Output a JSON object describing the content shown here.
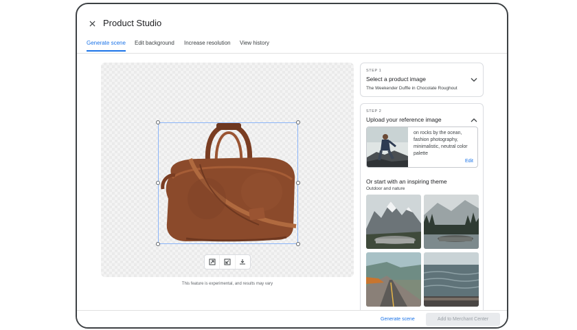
{
  "app": {
    "title": "Product Studio"
  },
  "tabs": [
    {
      "label": "Generate scene",
      "active": true
    },
    {
      "label": "Edit background",
      "active": false
    },
    {
      "label": "Increase resolution",
      "active": false
    },
    {
      "label": "View history",
      "active": false
    }
  ],
  "canvas": {
    "disclaimer": "This feature is experimental, and results may vary",
    "toolbar_icons": [
      "fit-to-frame-icon",
      "shrink-product-icon",
      "download-icon"
    ]
  },
  "step1": {
    "label": "STEP 1",
    "title": "Select a product image",
    "subtitle": "The Weekender Duffle in Chocolate Roughout",
    "expanded": false
  },
  "step2": {
    "label": "STEP 2",
    "title": "Upload your reference image",
    "expanded": true,
    "prompt": "on rocks by the ocean, fashion photography, minimalistic, neutral color palette",
    "edit_label": "Edit",
    "theme_title": "Or start with an inspiring theme",
    "theme_category": "Outdoor and nature",
    "themes": [
      "mountain-pedestal",
      "forest-lake-pedestal",
      "coastal-road",
      "ocean-waves"
    ]
  },
  "footer": {
    "generate_label": "Generate scene",
    "merchant_label": "Add to Merchant Center",
    "merchant_disabled": true
  },
  "colors": {
    "accent": "#1a73e8",
    "leather": "#8b4a2b",
    "disabled_bg": "#e8eaed"
  }
}
